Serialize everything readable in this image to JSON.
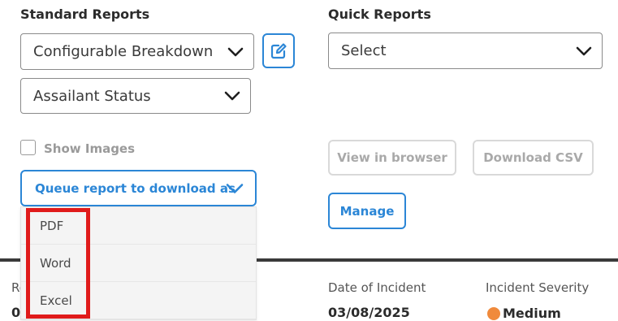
{
  "standard_reports": {
    "title": "Standard Reports",
    "report_select_value": "Configurable Breakdown",
    "sub_select_value": "Assailant Status",
    "show_images_label": "Show Images",
    "show_images_checked": false,
    "queue_button_label": "Queue report to download as",
    "download_formats": [
      "PDF",
      "Word",
      "Excel"
    ]
  },
  "quick_reports": {
    "title": "Quick Reports",
    "select_value": "Select",
    "view_button_label": "View in browser",
    "csv_button_label": "Download CSV",
    "manage_button_label": "Manage"
  },
  "table": {
    "headers": {
      "col_a": "Re",
      "date": "Date of Incident",
      "severity": "Incident Severity"
    },
    "first_row": {
      "col_a": "0",
      "date": "03/08/2025",
      "severity": "Medium"
    }
  },
  "colors": {
    "accent": "#2b86d6",
    "highlight": "#e01b1b",
    "severity_medium": "#f08a3c"
  }
}
